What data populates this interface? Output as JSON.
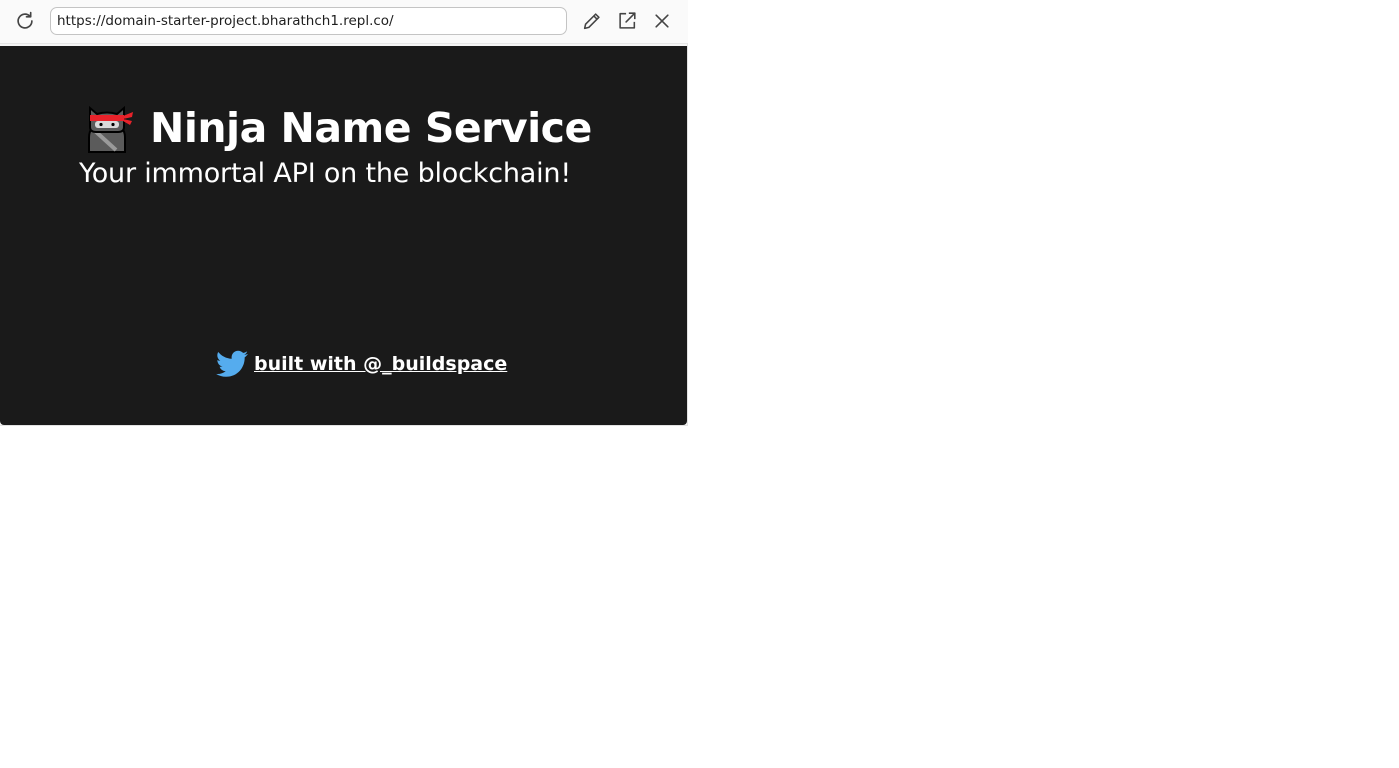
{
  "browser": {
    "url": "https://domain-starter-project.bharathch1.repl.co/",
    "icons": {
      "reload": "reload-icon",
      "edit": "pencil-icon",
      "open": "external-link-icon",
      "close": "close-icon"
    }
  },
  "app": {
    "title": "Ninja Name Service",
    "subtitle": "Your immortal API on the blockchain!",
    "logo_icon": "ninja-emoji-icon",
    "footer": {
      "icon": "twitter-icon",
      "link_text": "built with @_buildspace"
    },
    "colors": {
      "background": "#1a1a1a",
      "text": "#ffffff",
      "twitter_blue": "#55acee",
      "ninja_band": "#e8222a"
    }
  }
}
